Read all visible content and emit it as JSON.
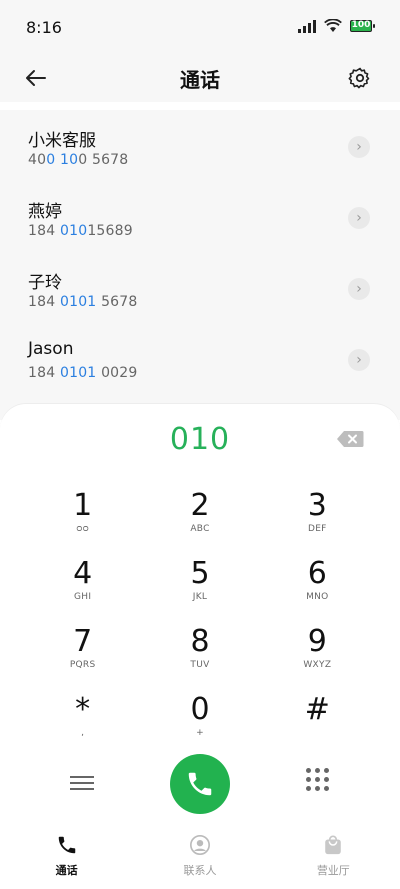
{
  "status": {
    "time": "8:16",
    "battery": "100"
  },
  "header": {
    "title": "通话"
  },
  "contacts": [
    {
      "name": "小米客服",
      "num_pre": "40",
      "num_hl": "0 10",
      "num_post": "0 5678"
    },
    {
      "name": "燕婷",
      "num_pre": "184 ",
      "num_hl": "010",
      "num_post": "15689"
    },
    {
      "name": "子玲",
      "num_pre": "184 ",
      "num_hl": "0101",
      "num_post": " 5678"
    },
    {
      "name": "Jason",
      "num_pre": "184 ",
      "num_hl": "0101",
      "num_post": " 0029"
    }
  ],
  "dialpad": {
    "entered": "010",
    "keys": [
      {
        "digit": "1",
        "letters": "ᴑᴑ"
      },
      {
        "digit": "2",
        "letters": "ABC"
      },
      {
        "digit": "3",
        "letters": "DEF"
      },
      {
        "digit": "4",
        "letters": "GHI"
      },
      {
        "digit": "5",
        "letters": "JKL"
      },
      {
        "digit": "6",
        "letters": "MNO"
      },
      {
        "digit": "7",
        "letters": "PQRS"
      },
      {
        "digit": "8",
        "letters": "TUV"
      },
      {
        "digit": "9",
        "letters": "WXYZ"
      },
      {
        "digit": "*",
        "letters": ","
      },
      {
        "digit": "0",
        "letters": "+"
      },
      {
        "digit": "#",
        "letters": ""
      }
    ]
  },
  "tabs": [
    {
      "label": "通话"
    },
    {
      "label": "联系人"
    },
    {
      "label": "营业厅"
    }
  ],
  "colors": {
    "accent_green": "#22b24f",
    "highlight_blue": "#2b7fe0"
  }
}
